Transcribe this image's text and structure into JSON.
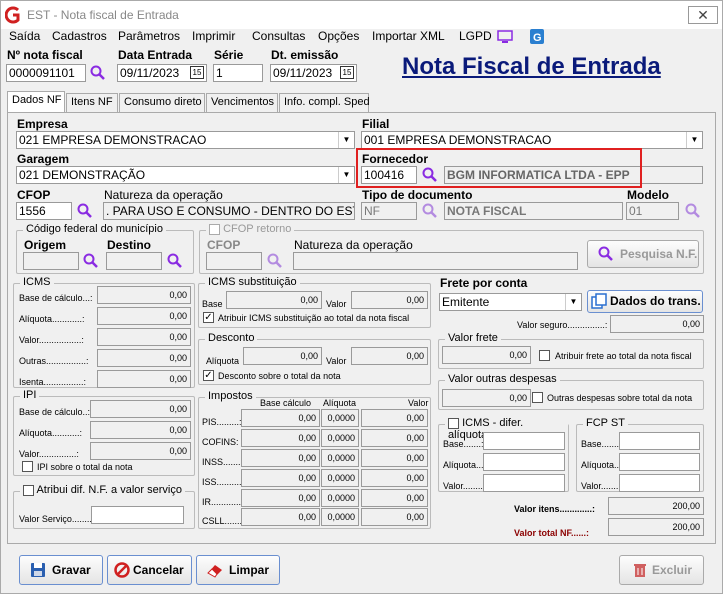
{
  "app": {
    "title": "EST - Nota fiscal de Entrada",
    "page_title": "Nota Fiscal de Entrada"
  },
  "menu": [
    "Saída",
    "Cadastros",
    "Parâmetros",
    "Imprimir",
    "Consultas",
    "Opções",
    "Importar XML",
    "LGPD"
  ],
  "header": {
    "nota_label": "Nº nota fiscal",
    "nota_value": "0000091101",
    "data_entrada_label": "Data Entrada",
    "data_entrada_value": "09/11/2023",
    "serie_label": "Série",
    "serie_value": "1",
    "dt_emissao_label": "Dt. emissão",
    "dt_emissao_value": "09/11/2023",
    "cal_label": "15"
  },
  "tabs": [
    "Dados NF",
    "Itens NF",
    "Consumo direto",
    "Vencimentos",
    "Info. compl. Sped"
  ],
  "form": {
    "empresa_label": "Empresa",
    "empresa_value": "021 EMPRESA DEMONSTRACAO",
    "filial_label": "Filial",
    "filial_value": "001 EMPRESA DEMONSTRACAO",
    "garagem_label": "Garagem",
    "garagem_value": "021 DEMONSTRAÇÃO",
    "fornecedor_label": "Fornecedor",
    "fornecedor_code": "100416",
    "fornecedor_name": "BGM INFORMATICA LTDA - EPP",
    "cfop_label": "CFOP",
    "cfop_value": "1556",
    "natureza_label": "Natureza da operação",
    "natureza_value": ". PARA USO E CONSUMO - DENTRO DO ESTADO",
    "tipo_doc_label": "Tipo de documento",
    "tipo_doc_code": "NF",
    "tipo_doc_name": "NOTA FISCAL",
    "modelo_label": "Modelo",
    "modelo_value": "01",
    "codigo_municipio_label": "Código federal do município",
    "origem_label": "Origem",
    "destino_label": "Destino",
    "cfop_retorno_label": "CFOP retorno",
    "cfop_ret_label": "CFOP",
    "natureza_ret_label": "Natureza da operação",
    "pesquisa_label": "Pesquisa N.F."
  },
  "icms": {
    "title": "ICMS",
    "rows": [
      {
        "label": "Base de cálculo...:",
        "value": "0,00"
      },
      {
        "label": "Alíquota............:",
        "value": "0,00"
      },
      {
        "label": "Valor.................:",
        "value": "0,00"
      },
      {
        "label": "Outras................:",
        "value": "0,00"
      },
      {
        "label": "Isenta................:",
        "value": "0,00"
      }
    ]
  },
  "icms_st": {
    "title": "ICMS substituição",
    "base_label": "Base",
    "base_value": "0,00",
    "valor_label": "Valor",
    "valor_value": "0,00",
    "check_label": "Atribuir ICMS substituição ao total da nota fiscal"
  },
  "desconto": {
    "title": "Desconto",
    "aliquota_label": "Alíquota",
    "aliquota_value": "0,00",
    "valor_label": "Valor",
    "valor_value": "0,00",
    "check_label": "Desconto sobre o total da nota"
  },
  "ipi": {
    "title": "IPI",
    "rows": [
      {
        "label": "Base de cálculo..:",
        "value": "0,00"
      },
      {
        "label": "Alíquota...........:",
        "value": "0,00"
      },
      {
        "label": "Valor...............:",
        "value": "0,00"
      }
    ],
    "check_label": "IPI sobre o total da nota"
  },
  "impostos": {
    "title": "Impostos",
    "col_base": "Base cálculo",
    "col_aliq": "Alíquota",
    "col_valor": "Valor",
    "rows": [
      {
        "label": "PIS.........:",
        "base": "0,00",
        "aliq": "0,0000",
        "valor": "0,00"
      },
      {
        "label": "COFINS:",
        "base": "0,00",
        "aliq": "0,0000",
        "valor": "0,00"
      },
      {
        "label": "INSS.......:",
        "base": "0,00",
        "aliq": "0,0000",
        "valor": "0,00"
      },
      {
        "label": "ISS..........:",
        "base": "0,00",
        "aliq": "0,0000",
        "valor": "0,00"
      },
      {
        "label": "IR............:",
        "base": "0,00",
        "aliq": "0,0000",
        "valor": "0,00"
      },
      {
        "label": "CSLL.......:",
        "base": "0,00",
        "aliq": "0,0000",
        "valor": "0,00"
      }
    ]
  },
  "atribui": {
    "check_label": "Atribui dif. N.F. a valor serviço",
    "valor_servico_label": "Valor Serviço..........:"
  },
  "frete": {
    "title": "Frete por conta",
    "value": "Emitente",
    "dados_trans_label": "Dados do trans.",
    "valor_seguro_label": "Valor seguro...............:",
    "valor_seguro_value": "0,00"
  },
  "valor_frete": {
    "title": "Valor frete",
    "value": "0,00",
    "check_label": "Atribuir frete ao total da nota fiscal"
  },
  "valor_outras": {
    "title": "Valor outras despesas",
    "value": "0,00",
    "check_label": "Outras despesas sobre total da nota"
  },
  "icms_dif": {
    "title": "ICMS - difer. alíquota",
    "base_label": "Base.......:",
    "aliquota_label": "Alíquota.......:",
    "valor_label": "Valor.........:"
  },
  "fcp": {
    "title": "FCP ST",
    "base_label": "Base.......:",
    "aliquota_label": "Alíquota.......:",
    "valor_label": "Valor.........:"
  },
  "totais": {
    "valor_itens_label": "Valor itens.............:",
    "valor_itens_value": "200,00",
    "valor_total_label": "Valor total NF......:",
    "valor_total_value": "200,00"
  },
  "buttons": {
    "gravar": "Gravar",
    "cancelar": "Cancelar",
    "limpar": "Limpar",
    "excluir": "Excluir"
  },
  "colors": {
    "title_blue": "#0a1a7a",
    "highlight": "#e02020",
    "dark_red": "#8b0000"
  }
}
